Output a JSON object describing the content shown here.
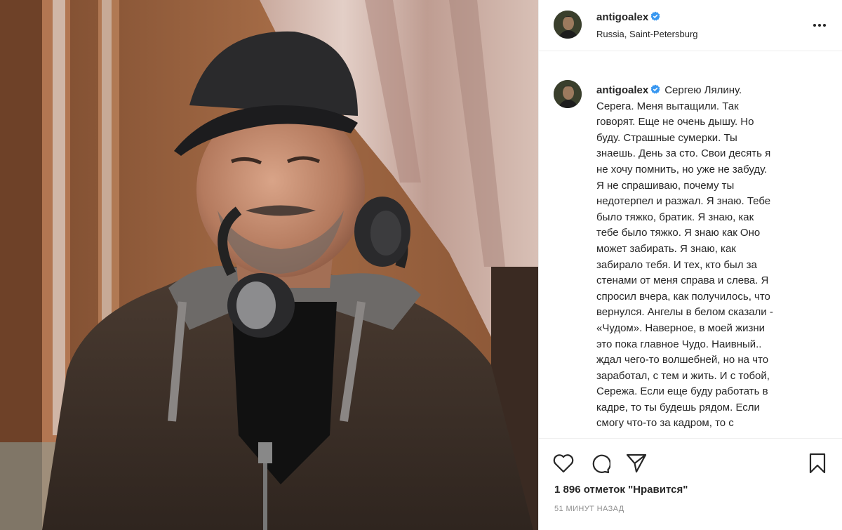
{
  "post": {
    "username": "antigoalex",
    "location": "Russia, Saint-Petersburg",
    "caption_lines": [
      "Сергею Лялину.",
      "Серега. Меня вытащили. Так",
      "говорят. Еще не очень дышу. Но",
      "буду. Страшные сумерки. Ты",
      "знаешь. День за сто. Свои десять я",
      "не хочу помнить, но уже не забуду.",
      "Я не спрашиваю, почему ты",
      "недотерпел и разжал. Я знаю. Тебе",
      "было тяжко, братик. Я знаю, как",
      "тебе было тяжко. Я знаю как Оно",
      "может забирать. Я знаю, как",
      "забирало тебя. И тех, кто был за",
      "стенами от меня справа и слева. Я",
      "спросил вчера, как получилось, что",
      "вернулся. Ангелы в белом сказали -",
      "«Чудом». Наверное, в моей жизни",
      "это пока главное Чудо. Наивный..",
      "ждал чего-то волшебней, но на что",
      "заработал, с тем и жить. И с тобой,",
      "Сережа. Если еще буду работать в",
      "кадре, то ты будешь рядом. Если",
      "смогу что-то за кадром, то с"
    ],
    "likes": "1 896 отметок \"Нравится\"",
    "time_ago": "51 МИНУТ НАЗАД"
  },
  "icons": {
    "verified": "verified-badge-icon",
    "more": "more-options-icon",
    "like": "heart-icon",
    "comment": "comment-icon",
    "share": "paper-plane-icon",
    "save": "bookmark-icon"
  },
  "colors": {
    "verified": "#3897f0",
    "text": "#262626",
    "muted": "#8e8e8e",
    "divider": "#efefef"
  }
}
